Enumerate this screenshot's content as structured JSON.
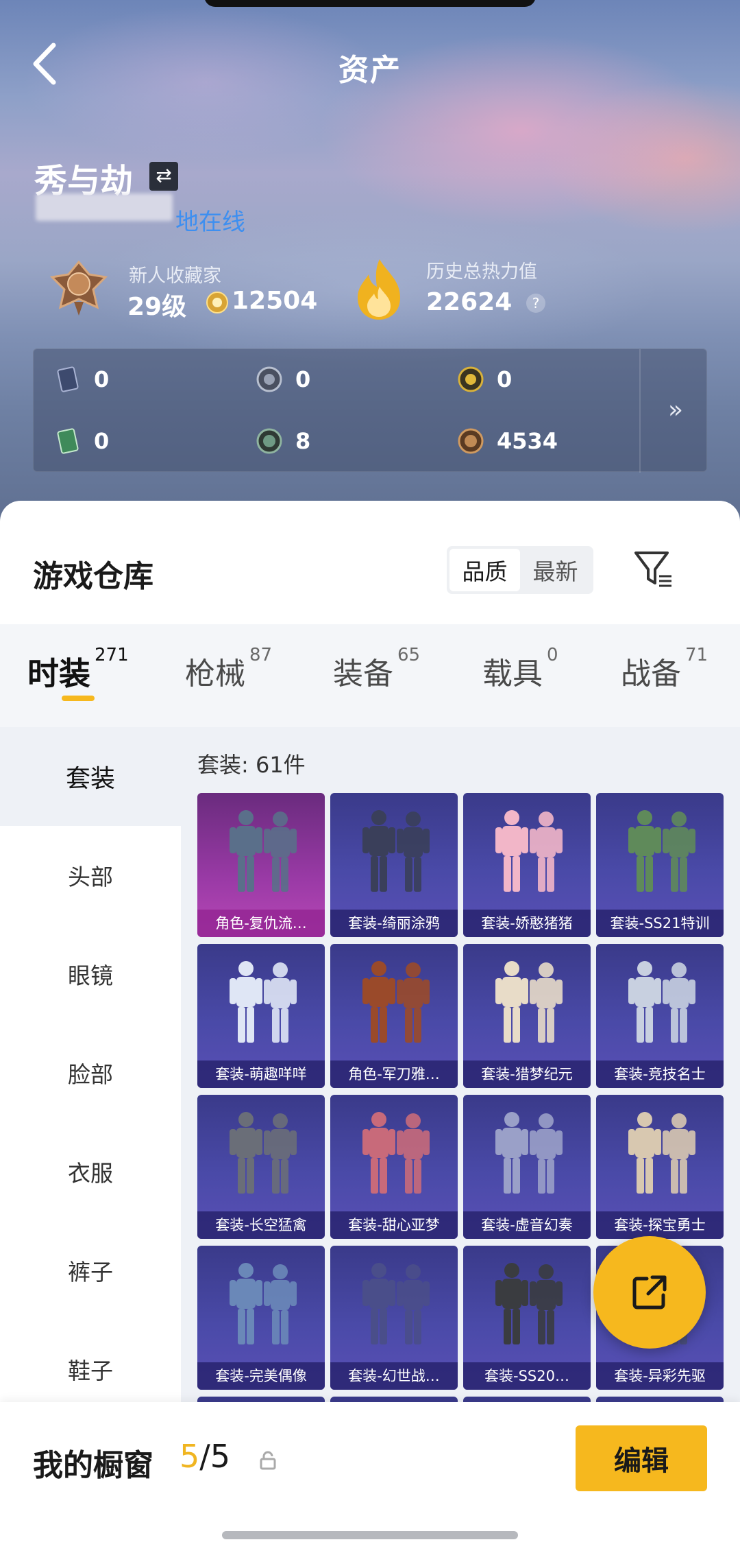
{
  "header": {
    "title": "资产"
  },
  "profile": {
    "name": "秀与劫",
    "online_text": "地在线",
    "rank_title": "新人收藏家",
    "level": "29级",
    "coins": "12504",
    "heat_title": "历史总热力值",
    "heat_value": "22624",
    "help_mark": "?"
  },
  "currencies": [
    {
      "icon": "card-icon",
      "value": "0",
      "color": "#3d4a6e"
    },
    {
      "icon": "silver-coin-icon",
      "value": "0",
      "color": "#7b8395"
    },
    {
      "icon": "gold-coin-icon",
      "value": "0",
      "color": "#c9a233"
    },
    {
      "icon": "green-card-icon",
      "value": "0",
      "color": "#3f8a5a"
    },
    {
      "icon": "green-orb-icon",
      "value": "8",
      "color": "#5d7a6a"
    },
    {
      "icon": "bronze-coin-icon",
      "value": "4534",
      "color": "#b07a45"
    }
  ],
  "panel_arrow": "»",
  "warehouse": {
    "title": "游戏仓库",
    "sort_options": [
      "品质",
      "最新"
    ],
    "active_sort": "品质"
  },
  "tabs": [
    {
      "label": "时装",
      "count": "271",
      "active": true
    },
    {
      "label": "枪械",
      "count": "87"
    },
    {
      "label": "装备",
      "count": "65"
    },
    {
      "label": "载具",
      "count": "0"
    },
    {
      "label": "战备",
      "count": "71"
    }
  ],
  "side_nav": [
    "套装",
    "头部",
    "眼镜",
    "脸部",
    "衣服",
    "裤子",
    "鞋子"
  ],
  "content": {
    "heading": "套装: 61件",
    "items": [
      {
        "label": "角色-复仇流…",
        "rarity": "pink",
        "fig": "#5a6f8a"
      },
      {
        "label": "套装-绮丽涂鸦",
        "rarity": "purple",
        "fig": "#3a3f5a"
      },
      {
        "label": "套装-娇憨猪猪",
        "rarity": "purple",
        "fig": "#f2b6c8"
      },
      {
        "label": "套装-SS21特训",
        "rarity": "purple",
        "fig": "#5f8a5a"
      },
      {
        "label": "套装-萌趣咩咩",
        "rarity": "purple",
        "fig": "#dfe6f5"
      },
      {
        "label": "角色-军刀雅…",
        "rarity": "purple",
        "fig": "#9a4a2a"
      },
      {
        "label": "套装-猎梦纪元",
        "rarity": "purple",
        "fig": "#e8dcc8"
      },
      {
        "label": "套装-竞技名士",
        "rarity": "purple",
        "fig": "#c8d0e0"
      },
      {
        "label": "套装-长空猛禽",
        "rarity": "purple",
        "fig": "#6a6e78"
      },
      {
        "label": "套装-甜心亚梦",
        "rarity": "purple",
        "fig": "#c86a7a"
      },
      {
        "label": "套装-虚音幻奏",
        "rarity": "purple",
        "fig": "#9aa0c8"
      },
      {
        "label": "套装-探宝勇士",
        "rarity": "purple",
        "fig": "#d8c8b0"
      },
      {
        "label": "套装-完美偶像",
        "rarity": "purple",
        "fig": "#6a88b8"
      },
      {
        "label": "套装-幻世战…",
        "rarity": "purple",
        "fig": "#4a4e8a"
      },
      {
        "label": "套装-SS20…",
        "rarity": "purple",
        "fig": "#3a3c40"
      },
      {
        "label": "套装-异彩先驱",
        "rarity": "purple",
        "fig": "#4a5078"
      }
    ]
  },
  "footer": {
    "showcase_label": "我的橱窗",
    "showcase_current": "5",
    "showcase_total": "/5",
    "edit_label": "编辑"
  }
}
